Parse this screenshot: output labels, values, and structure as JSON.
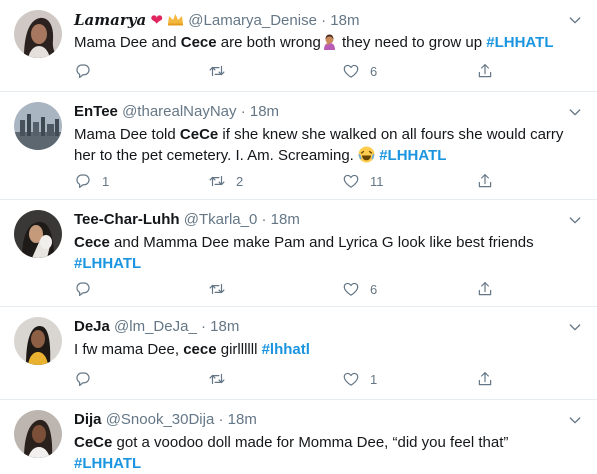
{
  "tweets": [
    {
      "name": "Lamarya",
      "handle": "@Lamarya_Denise",
      "dot": "·",
      "time": "18m",
      "text": {
        "p1": "Mama Dee and ",
        "b1": "Cece",
        "p2": " are both wrong",
        "p3": " they need to grow up ",
        "tag": "#LHHATL"
      },
      "reply_count": "",
      "retweet_count": "",
      "like_count": "6"
    },
    {
      "name": "EnTee",
      "handle": "@tharealNayNay",
      "dot": "·",
      "time": "18m",
      "text": {
        "p1": "Mama Dee told ",
        "b1": "CeCe",
        "p2": " if she knew she walked on all fours she would carry her to the pet cemetery. I. Am. Screaming. ",
        "tag": "#LHHATL"
      },
      "reply_count": "1",
      "retweet_count": "2",
      "like_count": "11"
    },
    {
      "name": "Tee-Char-Luhh",
      "handle": "@Tkarla_0",
      "dot": "·",
      "time": "18m",
      "text": {
        "b1": "Cece",
        "p1": " and Mamma Dee make Pam and Lyrica G look like best friends",
        "tag": "#LHHATL"
      },
      "reply_count": "",
      "retweet_count": "",
      "like_count": "6"
    },
    {
      "name": "DeJa",
      "handle": "@lm_DeJa_",
      "dot": "·",
      "time": "18m",
      "text": {
        "p1": "I fw mama Dee, ",
        "b1": "cece",
        "p2": " girllllll ",
        "tag": "#lhhatl"
      },
      "reply_count": "",
      "retweet_count": "",
      "like_count": "1"
    },
    {
      "name": "Dija",
      "handle": "@Snook_30Dija",
      "dot": "·",
      "time": "18m",
      "text": {
        "b1": "CeCe",
        "p1": " got a voodoo doll made for Momma Dee, “did you feel that”",
        "tag": "#LHHATL"
      }
    }
  ],
  "colors": {
    "text": "#14171a",
    "secondary": "#657786",
    "link": "#1b95e0",
    "divider": "#e6ecf0"
  },
  "icons": [
    "chevron-down-icon",
    "reply-icon",
    "retweet-icon",
    "like-icon",
    "share-icon",
    "heart-emoji",
    "crown-emoji",
    "woman-facepalming-emoji",
    "laughing-emoji"
  ]
}
